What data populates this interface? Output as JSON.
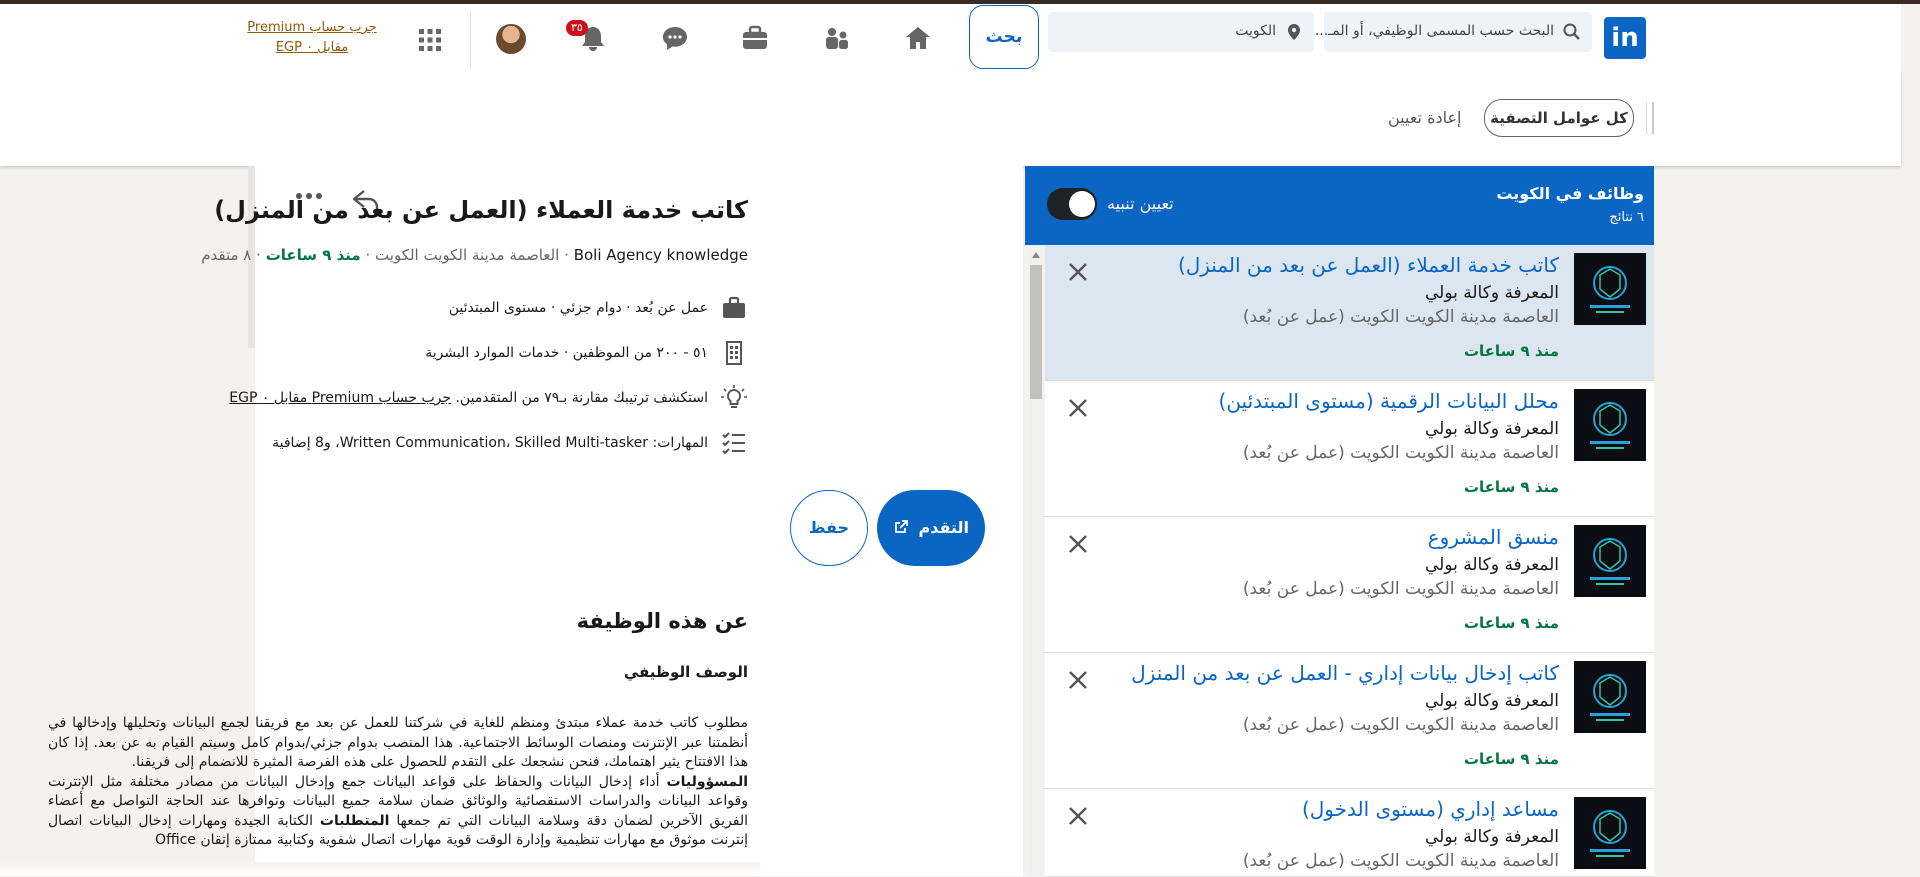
{
  "nav": {
    "logo": "in",
    "search_job_placeholder": "البحث حسب المسمى الوظيفي، أو المـ...",
    "search_location": "الكويت",
    "search_button": "بحث",
    "notifications_badge": "٣٥",
    "premium_link": "جرب حساب Premium مقابل ٠ EGP",
    "icons": [
      "linkedin-logo",
      "search-icon",
      "location-pin-icon",
      "home-icon",
      "network-icon",
      "briefcase-icon",
      "messaging-icon",
      "bell-icon",
      "avatar",
      "apps-grid-icon"
    ]
  },
  "filters": {
    "all_filters": "كل عوامل التصفية",
    "reset": "إعادة تعيين"
  },
  "list": {
    "title": "وظائف في الكويت",
    "count": "٦ نتائج",
    "alert_label": "تعيين تنبيه",
    "alert_on": true,
    "jobs": [
      {
        "title": "كاتب خدمة العملاء (العمل عن بعد من المنزل)",
        "company": "المعرفة وكالة بولي",
        "location": "العاصمة مدينة الكويت الكويت (عمل عن بُعد)",
        "time": "منذ ٩ ساعات",
        "active": true
      },
      {
        "title": "محلل البيانات الرقمية (مستوى المبتدئين)",
        "company": "المعرفة وكالة بولي",
        "location": "العاصمة مدينة الكويت الكويت (عمل عن بُعد)",
        "time": "منذ ٩ ساعات",
        "active": false
      },
      {
        "title": "منسق المشروع",
        "company": "المعرفة وكالة بولي",
        "location": "العاصمة مدينة الكويت الكويت (عمل عن بُعد)",
        "time": "منذ ٩ ساعات",
        "active": false
      },
      {
        "title": "كاتب إدخال بيانات إداري - العمل عن بعد من المنزل",
        "company": "المعرفة وكالة بولي",
        "location": "العاصمة مدينة الكويت الكويت (عمل عن بُعد)",
        "time": "منذ ٩ ساعات",
        "active": false
      },
      {
        "title": "مساعد إداري (مستوى الدخول)",
        "company": "المعرفة وكالة بولي",
        "location": "العاصمة مدينة الكويت الكويت (عمل عن بُعد)",
        "time": "",
        "active": false
      }
    ]
  },
  "detail": {
    "title": "كاتب خدمة العملاء (العمل عن بعد من المنزل)",
    "company": "Boli Agency knowledge",
    "location": "العاصمة مدينة الكويت الكويت",
    "posted": "منذ ٩ ساعات",
    "applicants": "٨ متقدم",
    "sep": "·",
    "work_type": "عمل عن بُعد · دوام جزئي · مستوى المبتدئين",
    "company_size": "٥١ - ٢٠٠ من الموظفين · خدمات الموارد البشرية",
    "insight_text": "استكشف ترتيبك مقارنة بـ٧٩ من المتقدمين.",
    "insight_link": "جرب حساب Premium مقابل ٠ EGP",
    "skills": "المهارات: Written Communication، Skilled Multi-tasker، و8 إضافية",
    "apply_button": "التقدم",
    "save_button": "حفظ",
    "about_heading": "عن هذه الوظيفة",
    "desc_heading": "الوصف الوظيفي",
    "desc_p1": "مطلوب كاتب خدمة عملاء مبتدئ ومنظم للغاية في شركتنا للعمل عن بعد مع فريقنا لجمع البيانات وتحليلها وإدخالها في أنظمتنا عبر الإنترنت ومنصات الوسائط الاجتماعية. هذا المنصب بدوام جزئي/بدوام كامل وسيتم القيام به عن بعد. إذا كان هذا الافتتاح يثير اهتمامك، فنحن نشجعك على التقدم للحصول على هذه الفرصة المثيرة للانضمام إلى فريقنا.",
    "resp_label": "المسؤوليات",
    "resp_text": "أداء إدخال البيانات والحفاظ على قواعد البيانات جمع وإدخال البيانات من مصادر مختلفة مثل الإنترنت وقواعد البيانات والدراسات الاستقصائية والوثائق ضمان سلامة جميع البيانات وتوافرها عند الحاجة التواصل مع أعضاء الفريق الآخرين لضمان دقة وسلامة البيانات التي تم جمعها",
    "req_label": "المتطلبات",
    "req_text": "الكتابة الجيدة ومهارات إدخال البيانات اتصال إنترنت موثوق مع مهارات تنظيمية وإدارة الوقت قوية مهارات اتصال شفوية وكتابية ممتازة إتقان Office"
  },
  "colors": {
    "brand": "#0a66c2",
    "success": "#057642",
    "premium": "#915907",
    "badge": "#cc1016"
  }
}
